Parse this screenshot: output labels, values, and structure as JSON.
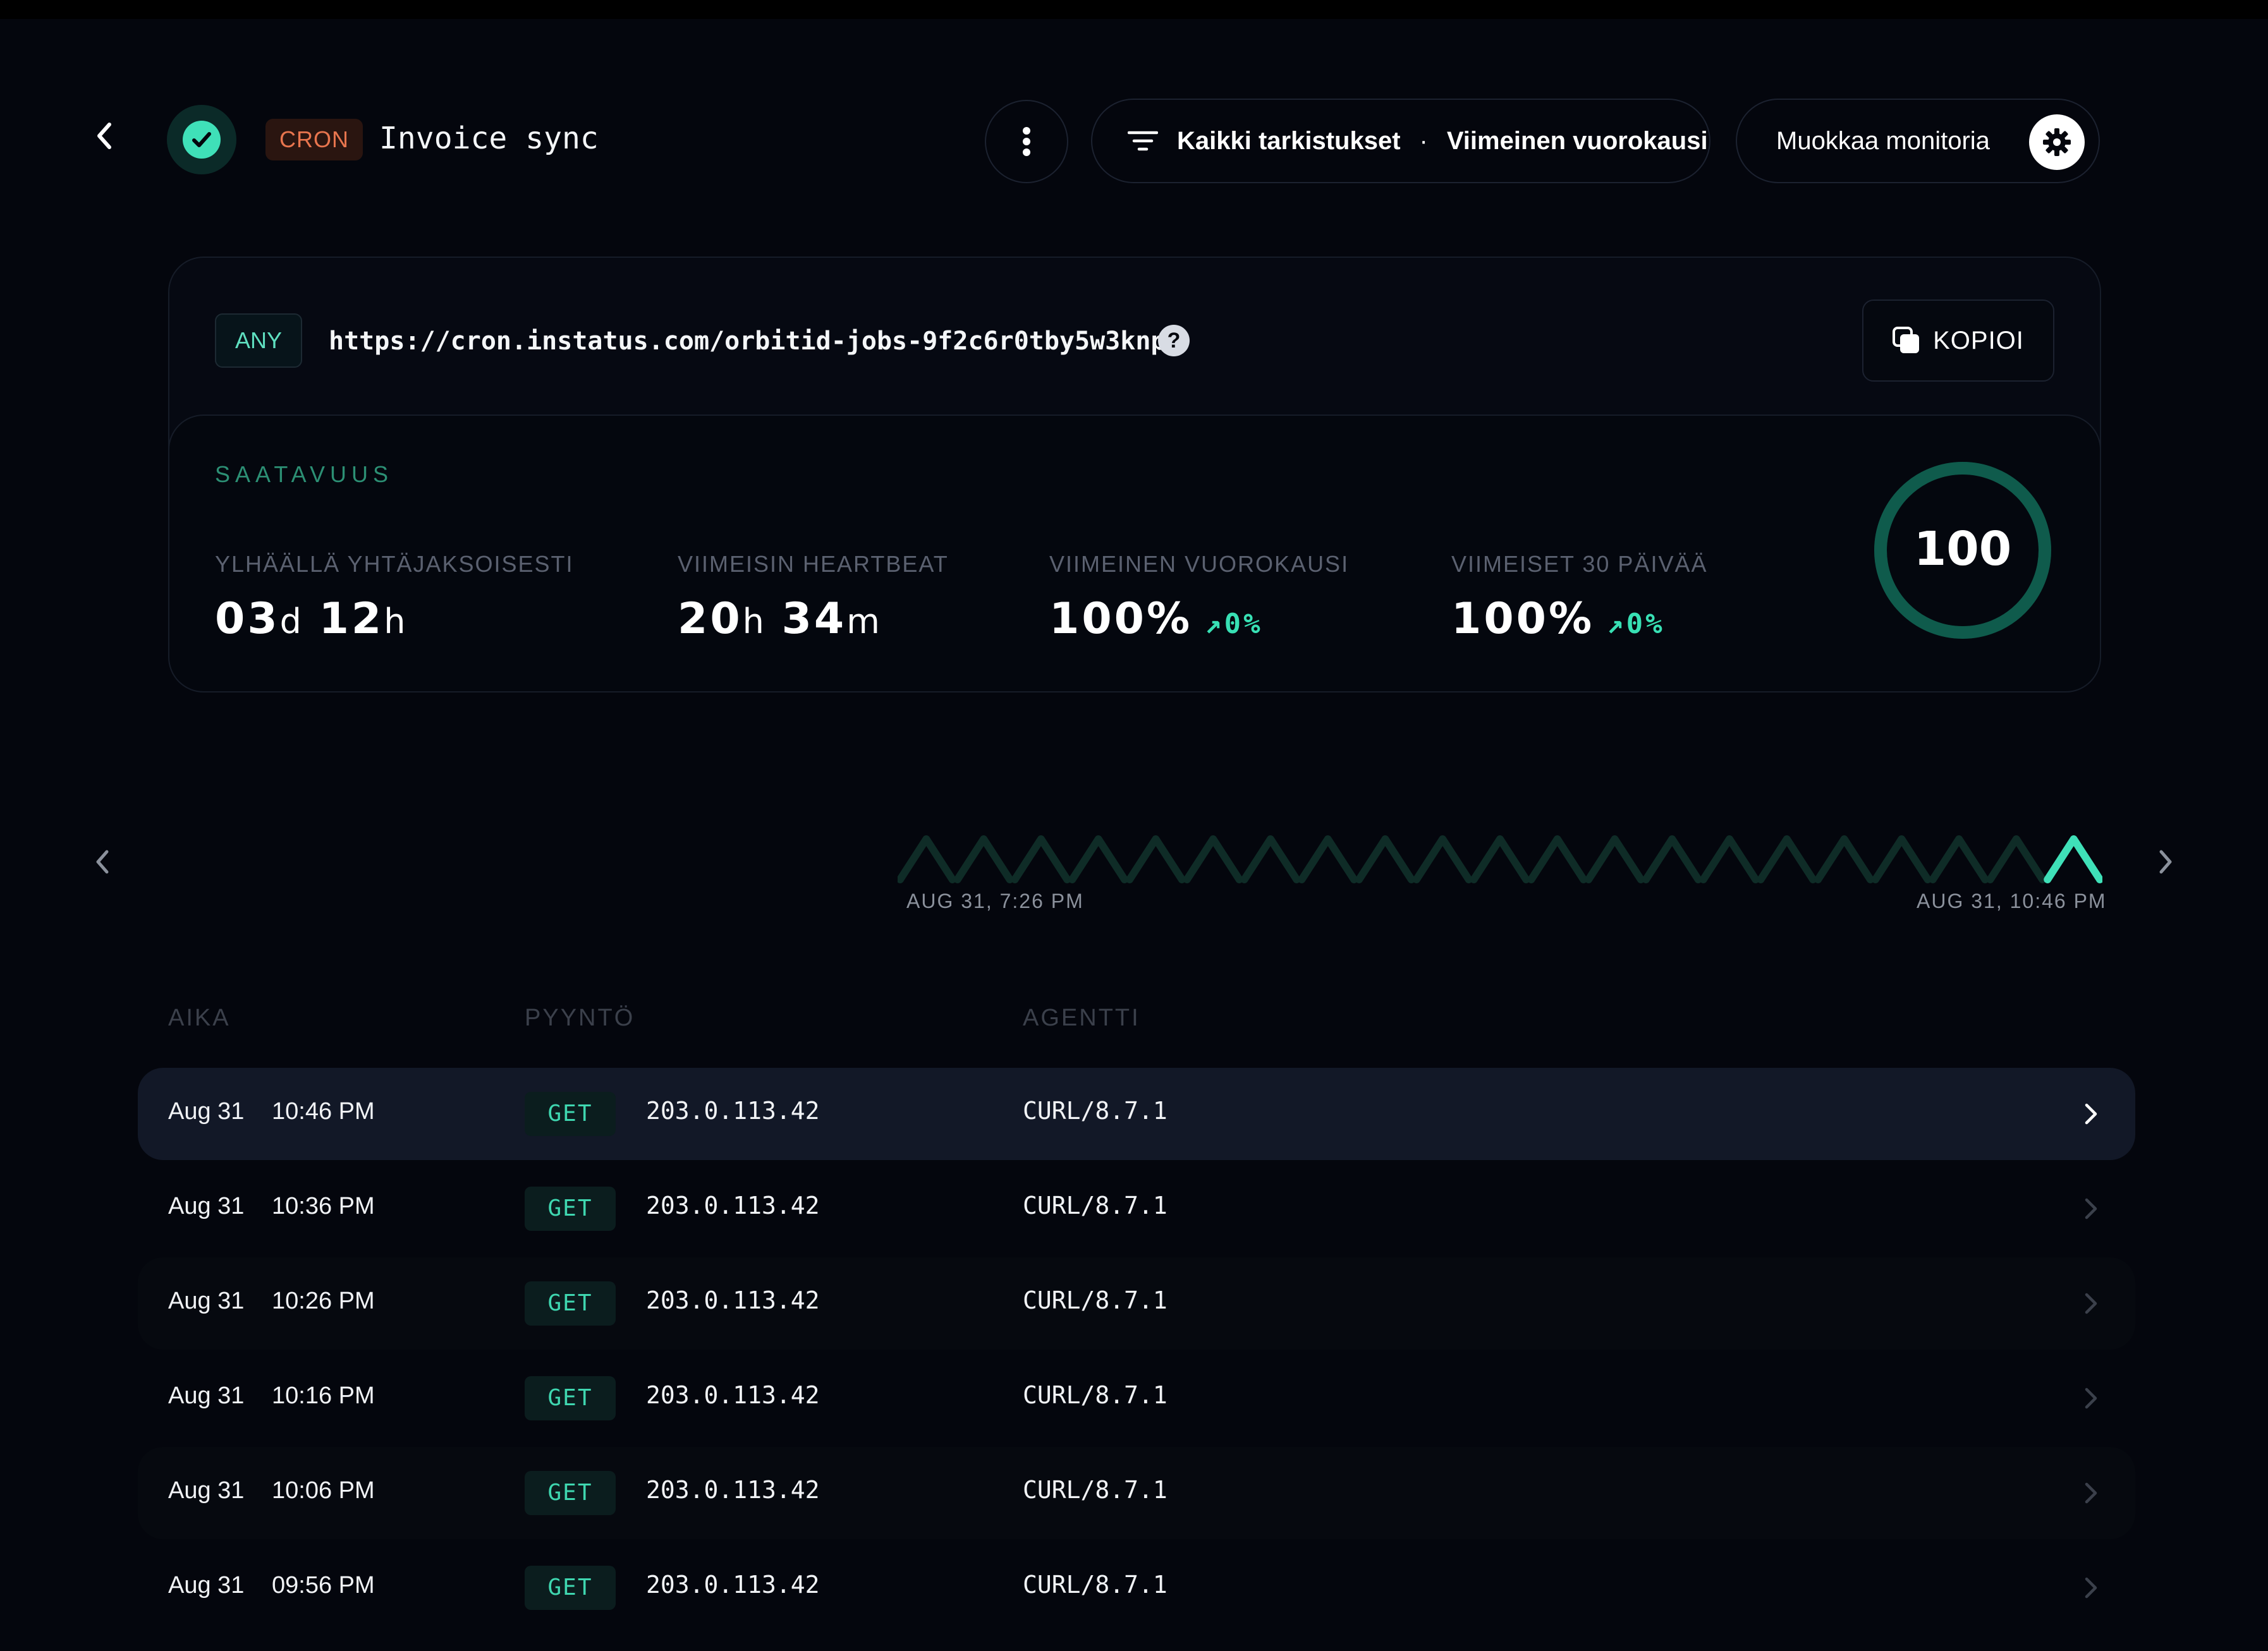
{
  "header": {
    "type_badge": "CRON",
    "title": "Invoice sync",
    "filter_checks": "Kaikki tarkistukset",
    "filter_separator": "·",
    "filter_range": "Viimeinen vuorokausi",
    "edit_label": "Muokkaa monitoria"
  },
  "endpoint": {
    "method_badge": "ANY",
    "url": "https://cron.instatus.com/orbitid-jobs-9f2c6r0tby5w3knp",
    "help": "?",
    "copy_label": "KOPIOI"
  },
  "availability": {
    "title": "SAATAVUUS",
    "uptime_label": "YLHÄÄLLÄ YHTÄJAKSOISESTI",
    "uptime_days": "03",
    "uptime_days_unit": "d",
    "uptime_hours": "12",
    "uptime_hours_unit": "h",
    "heartbeat_label": "VIIMEISIN HEARTBEAT",
    "heartbeat_hours": "20",
    "heartbeat_hours_unit": "h",
    "heartbeat_minutes": "34",
    "heartbeat_minutes_unit": "m",
    "day_label": "VIIMEINEN VUOROKAUSI",
    "day_value": "100%",
    "day_trend": "0%",
    "month_label": "VIIMEISET 30 PÄIVÄÄ",
    "month_value": "100%",
    "month_trend": "0%",
    "score": "100",
    "score_fraction": 1.0
  },
  "timeline": {
    "start_label": "AUG 31, 7:26 PM",
    "end_label": "AUG 31, 10:46 PM",
    "beat_count": 21,
    "active_index": 20,
    "colors": {
      "idle": "#0f2c27",
      "active": "#3fe0b8"
    }
  },
  "table": {
    "headers": {
      "time": "AIKA",
      "request": "PYYNTÖ",
      "agent": "AGENTTI"
    },
    "rows": [
      {
        "date": "Aug 31",
        "time": "10:46 PM",
        "method": "GET",
        "ip": "203.0.113.42",
        "agent": "CURL/8.7.1"
      },
      {
        "date": "Aug 31",
        "time": "10:36 PM",
        "method": "GET",
        "ip": "203.0.113.42",
        "agent": "CURL/8.7.1"
      },
      {
        "date": "Aug 31",
        "time": "10:26 PM",
        "method": "GET",
        "ip": "203.0.113.42",
        "agent": "CURL/8.7.1"
      },
      {
        "date": "Aug 31",
        "time": "10:16 PM",
        "method": "GET",
        "ip": "203.0.113.42",
        "agent": "CURL/8.7.1"
      },
      {
        "date": "Aug 31",
        "time": "10:06 PM",
        "method": "GET",
        "ip": "203.0.113.42",
        "agent": "CURL/8.7.1"
      },
      {
        "date": "Aug 31",
        "time": "09:56 PM",
        "method": "GET",
        "ip": "203.0.113.42",
        "agent": "CURL/8.7.1"
      }
    ]
  },
  "icons": {
    "back": "chevron-left-icon",
    "status": "check-circle-icon",
    "more": "more-vertical-icon",
    "filter": "filter-lines-icon",
    "settings": "gear-icon",
    "copy": "copy-icon",
    "help": "question-circle-icon",
    "row_open": "chevron-right-icon"
  },
  "colors": {
    "background": "#04060d",
    "accent": "#3fe0b8",
    "cron_badge": "#e8754e",
    "ring": "#0f5b4c"
  }
}
